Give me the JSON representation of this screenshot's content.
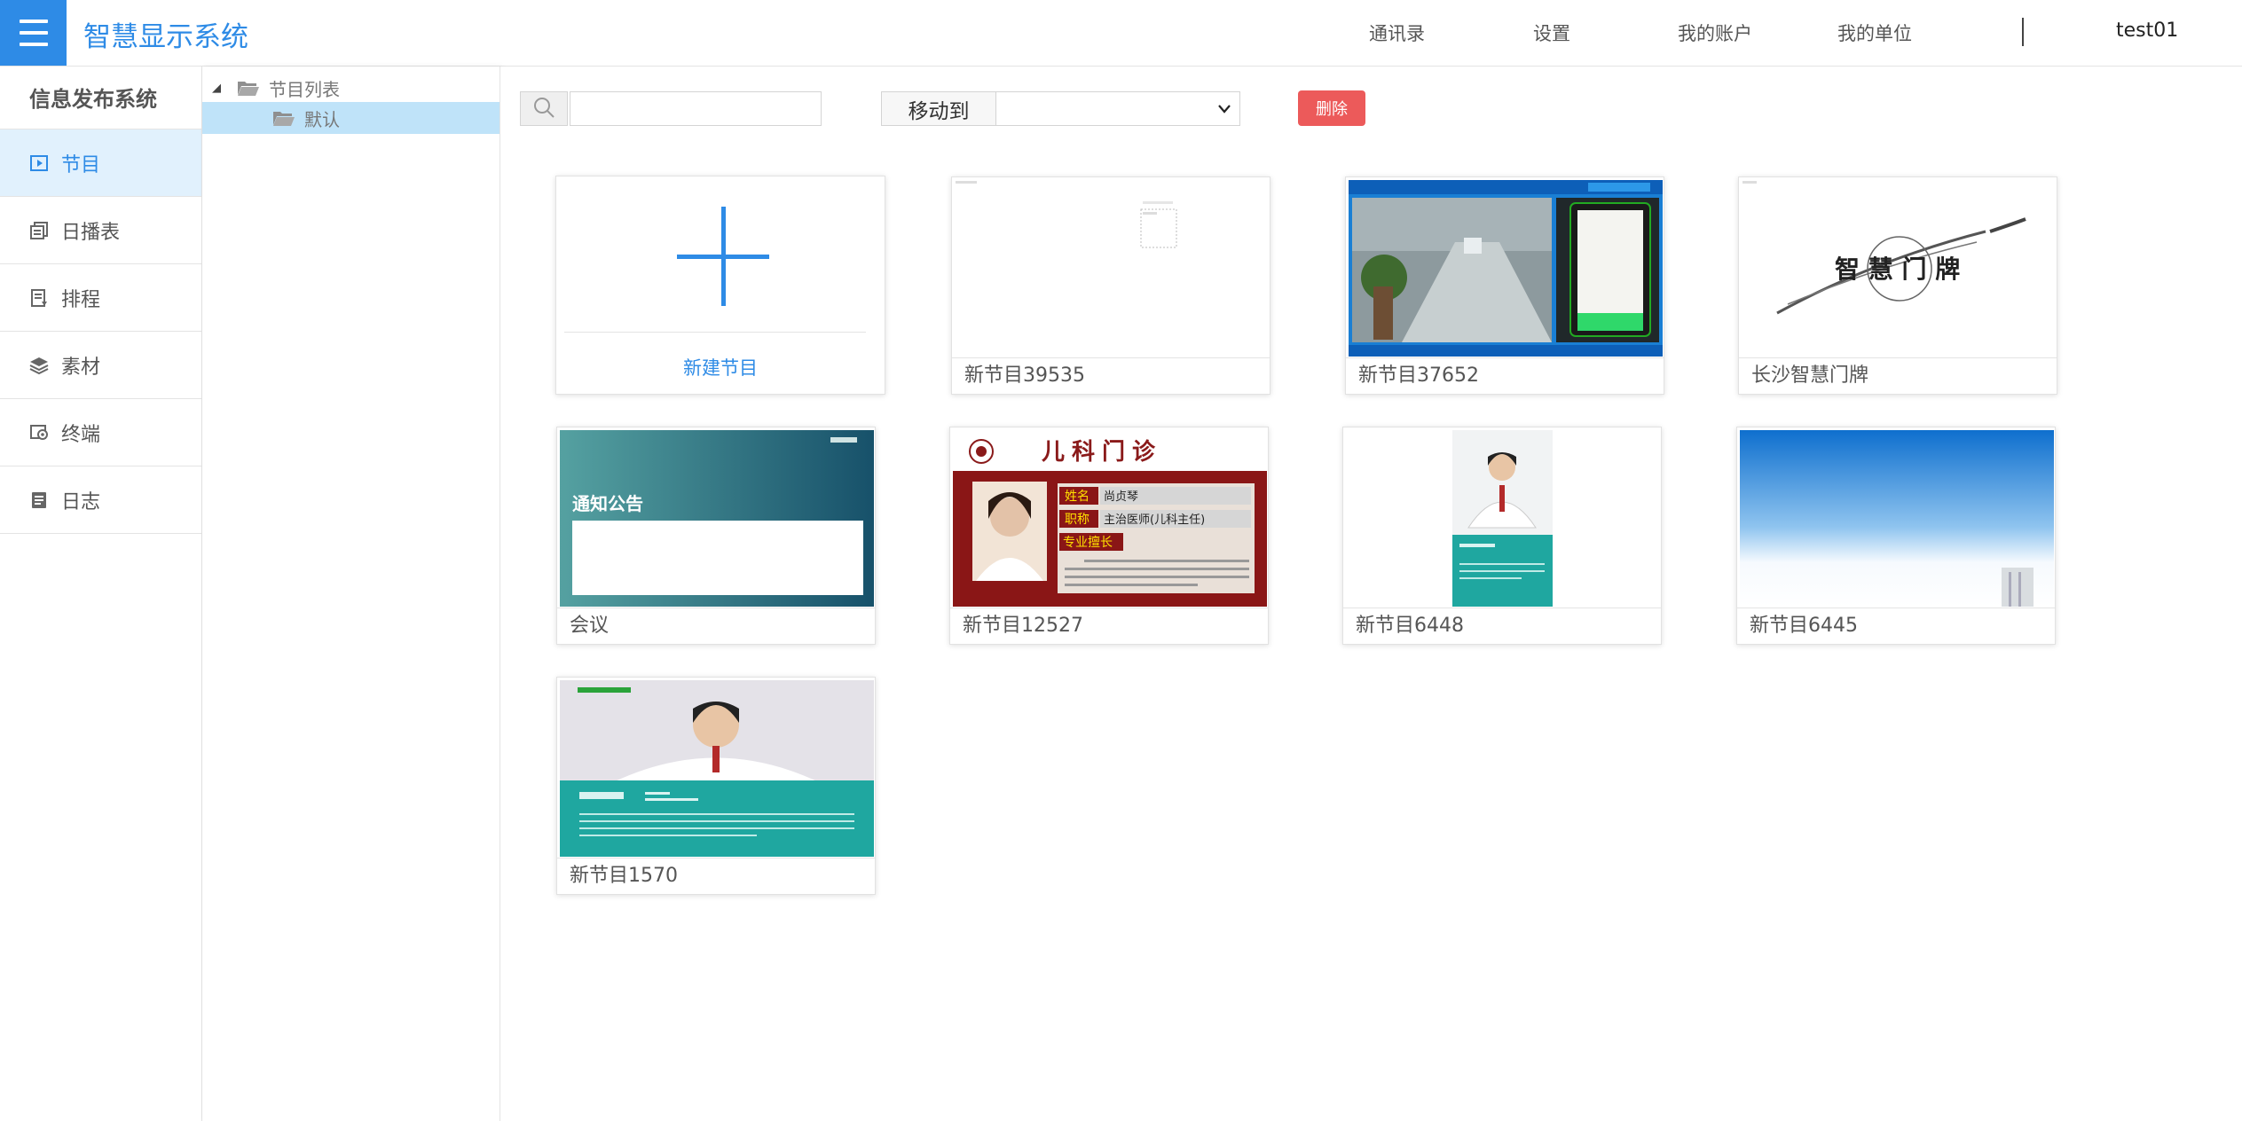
{
  "app": {
    "title": "智慧显示系统"
  },
  "topnav": {
    "contacts": "通讯录",
    "settings": "设置",
    "my_account": "我的账户",
    "my_unit": "我的单位",
    "username": "test01"
  },
  "sidebar": {
    "title": "信息发布系统",
    "items": [
      {
        "label": "节目",
        "icon": "program-icon",
        "active": true
      },
      {
        "label": "日播表",
        "icon": "daily-schedule-icon"
      },
      {
        "label": "排程",
        "icon": "scheduling-icon"
      },
      {
        "label": "素材",
        "icon": "material-layers-icon"
      },
      {
        "label": "终端",
        "icon": "terminal-icon"
      },
      {
        "label": "日志",
        "icon": "log-icon"
      }
    ]
  },
  "tree": {
    "root_label": "节目列表",
    "child_label": "默认"
  },
  "toolbar": {
    "search_placeholder": "",
    "moveto_label": "移动到",
    "moveto_selected": "",
    "delete_label": "删除"
  },
  "programs": {
    "new_label": "新建节目",
    "items": [
      {
        "name": "新节目39535",
        "thumbnail": "blank-layout"
      },
      {
        "name": "新节目37652",
        "thumbnail": "corridor-photo"
      },
      {
        "name": "长沙智慧门牌",
        "thumbnail": "smart-doorplate"
      },
      {
        "name": "会议",
        "thumbnail": "notice-board"
      },
      {
        "name": "新节目12527",
        "thumbnail": "pediatric-clinic"
      },
      {
        "name": "新节目6448",
        "thumbnail": "doctor-portrait-teal"
      },
      {
        "name": "新节目6445",
        "thumbnail": "blue-gradient"
      },
      {
        "name": "新节目1570",
        "thumbnail": "doctor-profile-teal"
      }
    ]
  },
  "thumb_text": {
    "doorplate": "智 慧 门 牌",
    "notice": "通知公告",
    "clinic_title": "儿科门诊",
    "clinic_name_key": "姓名",
    "clinic_name_val": "尚贞琴",
    "clinic_title_key": "职称",
    "clinic_title_val": "主治医师(儿科主任)",
    "clinic_spec_key": "专业擅长"
  },
  "colors": {
    "accent": "#2e8be6",
    "active_bg": "#e1f1fd",
    "tree_selected": "#bfe3f9",
    "danger": "#ec5a5a"
  }
}
